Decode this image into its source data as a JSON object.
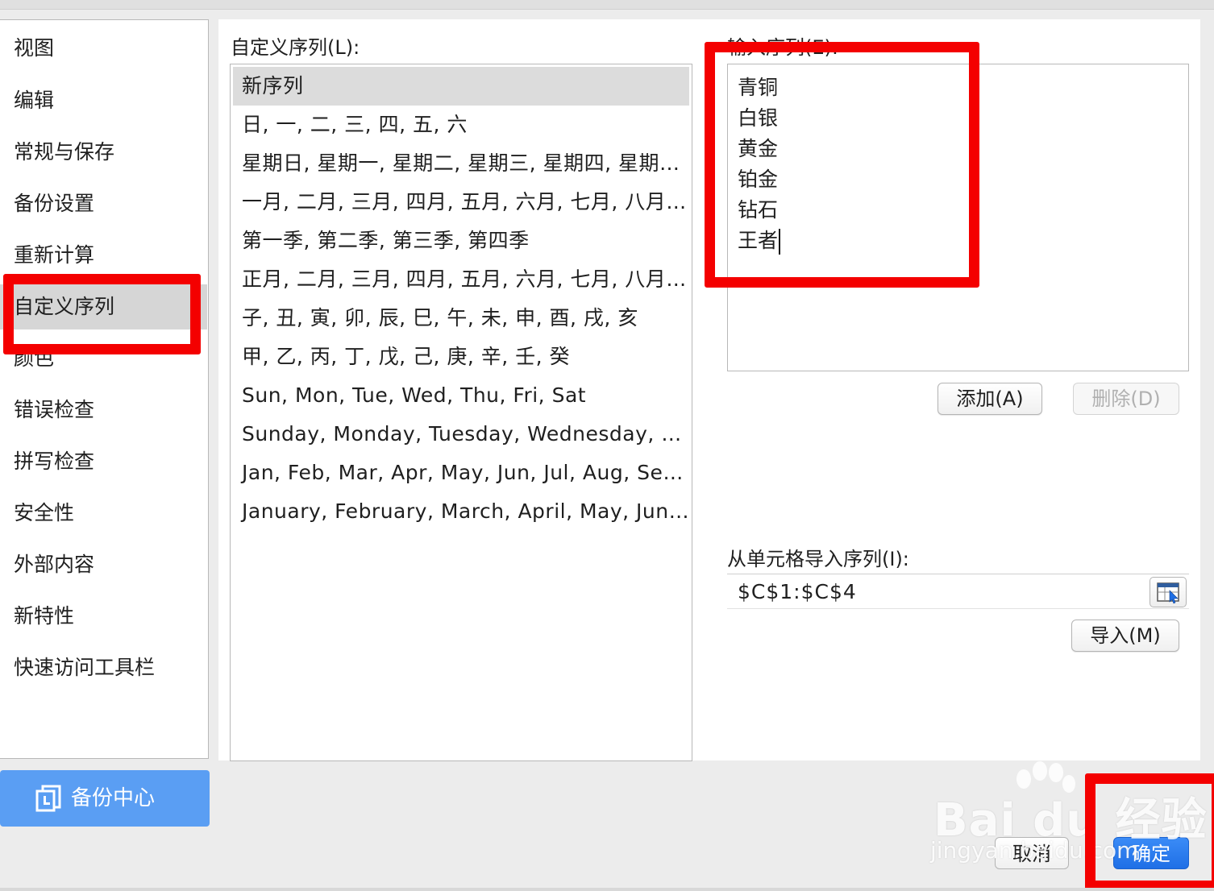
{
  "sidebar": {
    "items": [
      {
        "label": "视图"
      },
      {
        "label": "编辑"
      },
      {
        "label": "常规与保存"
      },
      {
        "label": "备份设置"
      },
      {
        "label": "重新计算"
      },
      {
        "label": "自定义序列",
        "selected": true
      },
      {
        "label": "颜色"
      },
      {
        "label": "错误检查"
      },
      {
        "label": "拼写检查"
      },
      {
        "label": "安全性"
      },
      {
        "label": "外部内容"
      },
      {
        "label": "新特性"
      },
      {
        "label": "快速访问工具栏"
      }
    ]
  },
  "backup_center": {
    "label": "备份中心",
    "icon": "backup-icon"
  },
  "custom_lists": {
    "label": "自定义序列(L):",
    "items": [
      "新序列",
      "日, 一, 二, 三, 四, 五, 六",
      "星期日, 星期一, 星期二, 星期三, 星期四, 星期五, 星期六",
      "一月, 二月, 三月, 四月, 五月, 六月, 七月, 八月, 九月, 十月, 十一月, 十二月",
      "第一季, 第二季, 第三季, 第四季",
      "正月, 二月, 三月, 四月, 五月, 六月, 七月, 八月, 九月, 十月, 冬月, 腊月",
      "子, 丑, 寅, 卯, 辰, 巳, 午, 未, 申, 酉, 戌, 亥",
      "甲, 乙, 丙, 丁, 戊, 己, 庚, 辛, 壬, 癸",
      "Sun, Mon, Tue, Wed, Thu, Fri, Sat",
      "Sunday, Monday, Tuesday, Wednesday, Thursday, Friday, Saturday",
      "Jan, Feb, Mar, Apr, May, Jun, Jul, Aug, Sep, Oct, Nov, Dec",
      "January, February, March, April, May, June, July, August, September, October, November, December"
    ],
    "selected_index": 0
  },
  "entries": {
    "label": "输入序列(E):",
    "lines": [
      "青铜",
      "白银",
      "黄金",
      "铂金",
      "钻石",
      "王者"
    ]
  },
  "buttons": {
    "add": "添加(A)",
    "delete": "删除(D)",
    "import": "导入(M)",
    "cancel": "取消",
    "ok": "确定"
  },
  "import_from_cells": {
    "label": "从单元格导入序列(I):",
    "value": "$C$1:$C$4",
    "picker_icon": "range-select-icon"
  },
  "watermark": {
    "brand": "Bai du 经验",
    "url": "jingyan.baidu.com"
  },
  "colors": {
    "accent": "#1f6fe6",
    "backup_button": "#5a9ef3",
    "annotation_red": "#f40000",
    "selection": "#d6d6d6"
  }
}
